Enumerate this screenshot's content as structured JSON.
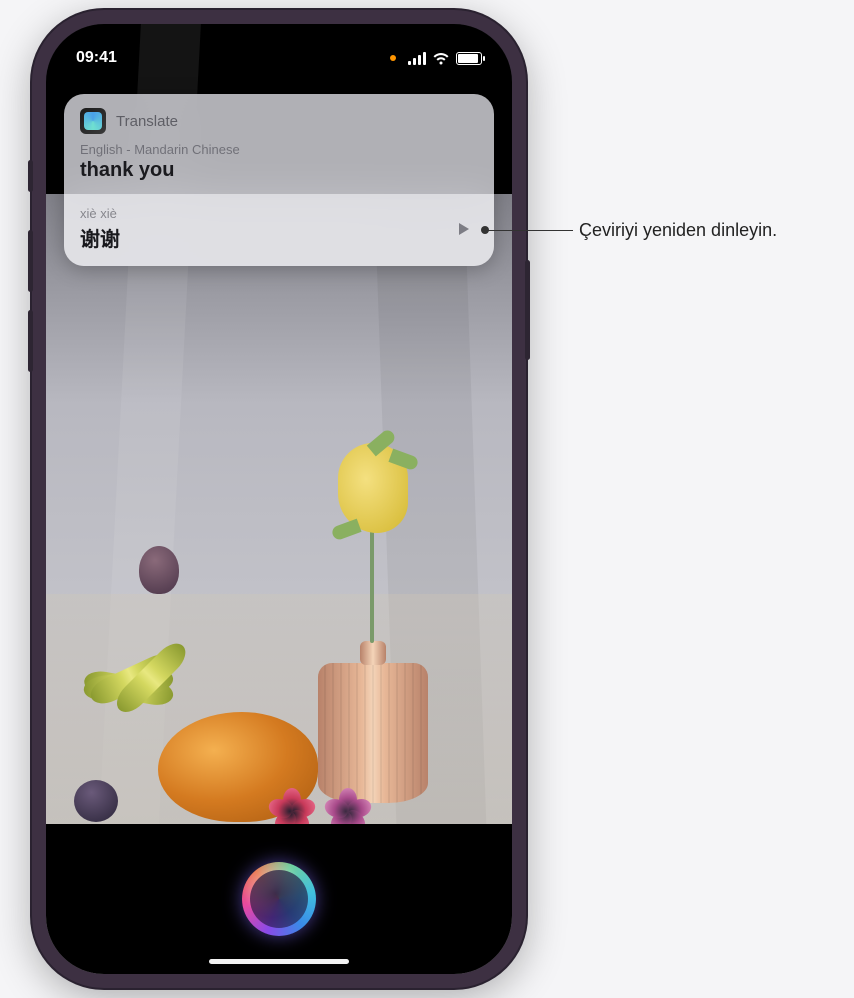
{
  "status": {
    "time": "09:41"
  },
  "card": {
    "app_name": "Translate",
    "lang_pair": "English - Mandarin Chinese",
    "source_text": "thank you",
    "pinyin": "xiè xiè",
    "target_text": "谢谢"
  },
  "callout": {
    "play_description": "Çeviriyi yeniden dinleyin."
  }
}
